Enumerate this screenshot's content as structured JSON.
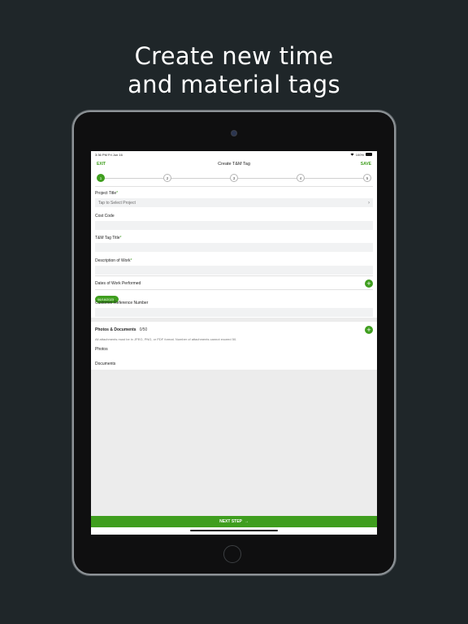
{
  "headline": {
    "line1": "Create new time",
    "line2": "and material tags"
  },
  "statusbar": {
    "time": "3:36 PM",
    "date": "Fri Jun 16",
    "battery": "100%"
  },
  "navbar": {
    "exit_label": "EXIT",
    "title": "Create T&M Tag",
    "save_label": "SAVE"
  },
  "stepper": {
    "steps": [
      "1",
      "2",
      "3",
      "4",
      "5"
    ],
    "current_step": 1
  },
  "form": {
    "project_title": {
      "label": "Project Title",
      "required_mark": "*",
      "placeholder": "Tap to Select Project"
    },
    "cost_code": {
      "label": "Cost Code",
      "value": ""
    },
    "tm_tag_title": {
      "label": "T&M Tag Title",
      "required_mark": "*",
      "value": ""
    },
    "description_of_work": {
      "label": "Description of Work",
      "required_mark": "*",
      "value": ""
    },
    "dates_of_work": {
      "label": "Dates of Work Performed",
      "dates": [
        "06/16/2023"
      ]
    },
    "customer_reference": {
      "label": "Customer Reference Number",
      "value": ""
    }
  },
  "attachments": {
    "title": "Photos & Documents",
    "count": "0/50",
    "note": "All attachments must be in JPEG, PNG, or PDF format. Number of attachments cannot exceed 50.",
    "photos_label": "Photos",
    "documents_label": "Documents"
  },
  "footer": {
    "next_step_label": "NEXT STEP",
    "next_arrow": "→"
  },
  "colors": {
    "background": "#1f2629",
    "accent": "#3f9e1e",
    "input_fill": "#f1f2f3"
  },
  "icons": {
    "chevron": "chevron-right-icon",
    "add": "plus-circle-icon",
    "wifi": "wifi-icon",
    "battery": "battery-icon",
    "arrow": "arrow-right-icon"
  }
}
